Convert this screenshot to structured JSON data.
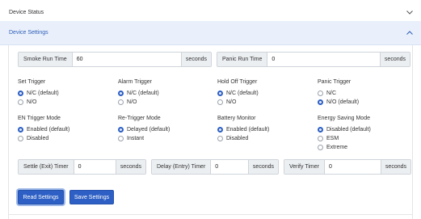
{
  "accordion": {
    "device_status_title": "Device Status",
    "device_settings_title": "Device Settings"
  },
  "timers_top": {
    "smoke_run_time": {
      "label": "Smoke Run Time",
      "value": "60",
      "unit": "seconds"
    },
    "panic_run_time": {
      "label": "Panic Run Time",
      "value": "0",
      "unit": "seconds"
    }
  },
  "groups": [
    {
      "title": "Set Trigger",
      "options": [
        {
          "label": "N/C (default)",
          "selected": true
        },
        {
          "label": "N/O",
          "selected": false
        }
      ]
    },
    {
      "title": "Alarm Trigger",
      "options": [
        {
          "label": "N/C (default)",
          "selected": true
        },
        {
          "label": "N/O",
          "selected": false
        }
      ]
    },
    {
      "title": "Hold Off Trigger",
      "options": [
        {
          "label": "N/C (default)",
          "selected": true
        },
        {
          "label": "N/O",
          "selected": false
        }
      ]
    },
    {
      "title": "Panic Trigger",
      "options": [
        {
          "label": "N/C",
          "selected": false
        },
        {
          "label": "N/O (default)",
          "selected": true
        }
      ]
    },
    {
      "title": "EN Trigger Mode",
      "options": [
        {
          "label": "Enabled (default)",
          "selected": true
        },
        {
          "label": "Disabled",
          "selected": false
        }
      ]
    },
    {
      "title": "Re-Trigger Mode",
      "options": [
        {
          "label": "Delayed (default)",
          "selected": true
        },
        {
          "label": "Instant",
          "selected": false
        }
      ]
    },
    {
      "title": "Battery Monitor",
      "options": [
        {
          "label": "Enabled (default)",
          "selected": true
        },
        {
          "label": "Disabled",
          "selected": false
        }
      ]
    },
    {
      "title": "Energy Saving Mode",
      "options": [
        {
          "label": "Disabled (default)",
          "selected": true
        },
        {
          "label": "ESM",
          "selected": false
        },
        {
          "label": "Extreme",
          "selected": false
        }
      ]
    }
  ],
  "timers_bottom": {
    "settle_timer": {
      "label": "Settle (Exit) Timer",
      "value": "0",
      "unit": "seconds"
    },
    "delay_timer": {
      "label": "Delay (Entry) Timer",
      "value": "0",
      "unit": "seconds"
    },
    "verify_timer": {
      "label": "Verify Timer",
      "value": "0",
      "unit": "seconds"
    }
  },
  "buttons": {
    "read_label": "Read Settings",
    "save_label": "Save Settings"
  },
  "colors": {
    "accent": "#2d5fc4",
    "header_active_bg": "#e9f0fb",
    "header_active_text": "#2f5db8"
  }
}
